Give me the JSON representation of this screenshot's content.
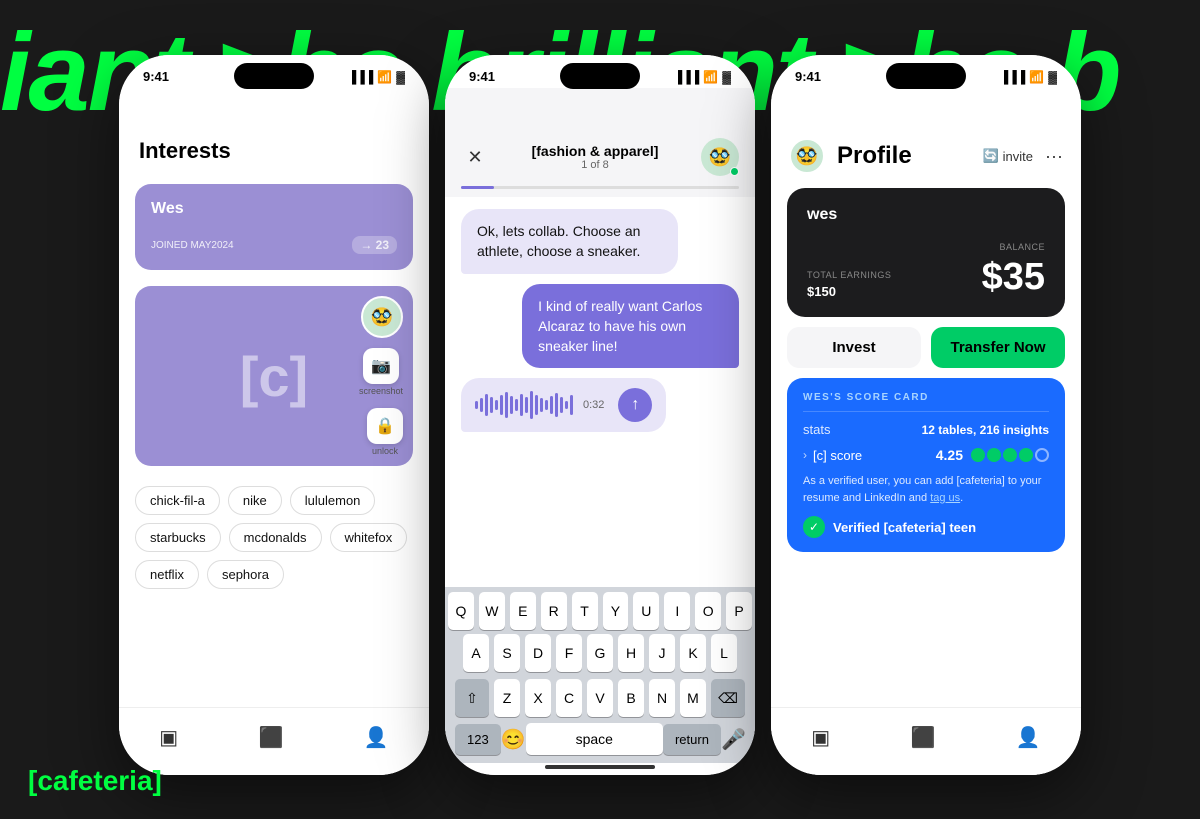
{
  "background": {
    "color": "#1a1a1a",
    "text": "iant >be brilliant >be b",
    "text_color": "#00ff41"
  },
  "brand": {
    "name": "[cafeteria]"
  },
  "phone1": {
    "time": "9:41",
    "screen_title": "Interests",
    "card1": {
      "name": "Wes",
      "joined": "JOINED MAY2024",
      "arrow": "→ 23"
    },
    "card2": {
      "bracket": "[c]",
      "screenshot_label": "screenshot",
      "unlock_label": "unlock"
    },
    "tags": [
      "chick-fil-a",
      "nike",
      "lululemon",
      "starbucks",
      "mcdonalds",
      "whitefox",
      "netflix",
      "sephora"
    ]
  },
  "phone2": {
    "time": "9:41",
    "chat_title": "[fashion & apparel]",
    "chat_subtitle": "1 of 8",
    "msg1": "Ok, lets collab. Choose an athlete, choose a sneaker.",
    "msg2": "I kind of really want Carlos Alcaraz to have his own sneaker line!",
    "audio_time": "0:32",
    "keys_row1": [
      "Q",
      "W",
      "E",
      "R",
      "T",
      "Y",
      "U",
      "I",
      "O",
      "P"
    ],
    "keys_row2": [
      "A",
      "S",
      "D",
      "F",
      "G",
      "H",
      "J",
      "K",
      "L"
    ],
    "keys_row3": [
      "Z",
      "X",
      "C",
      "V",
      "B",
      "N",
      "M"
    ],
    "key_123": "123",
    "key_space": "space",
    "key_return": "return"
  },
  "phone3": {
    "time": "9:41",
    "header_title": "Profile",
    "header_invite": "invite",
    "card": {
      "name": "wes",
      "total_earnings_label": "TOTAL EARNINGS",
      "total_earnings": "$150",
      "balance_label": "BALANCE",
      "balance": "$35"
    },
    "invest_label": "Invest",
    "transfer_label": "Transfer Now",
    "score_card": {
      "title": "WES'S SCORE CARD",
      "stats_label": "stats",
      "stats_value": "12 tables, 216 insights",
      "c_score_label": "[c] score",
      "c_score_value": "4.25",
      "stars_filled": 4,
      "stars_total": 5,
      "desc": "As a verified user, you can add [cafeteria] to your resume and LinkedIn and tag us.",
      "tag_us_link": "tag us",
      "verified_label": "Verified [cafeteria] teen"
    }
  },
  "icons": {
    "search": "🔍",
    "gear": "⚙️",
    "close": "✕",
    "chevron_down": "›",
    "lock": "🔒",
    "camera": "📷",
    "nav_cards": "▣",
    "nav_home": "⬛",
    "nav_profile": "👤",
    "check": "✓",
    "mic": "🎤",
    "emoji_face": "😊",
    "avatar_emoji": "🥸"
  }
}
